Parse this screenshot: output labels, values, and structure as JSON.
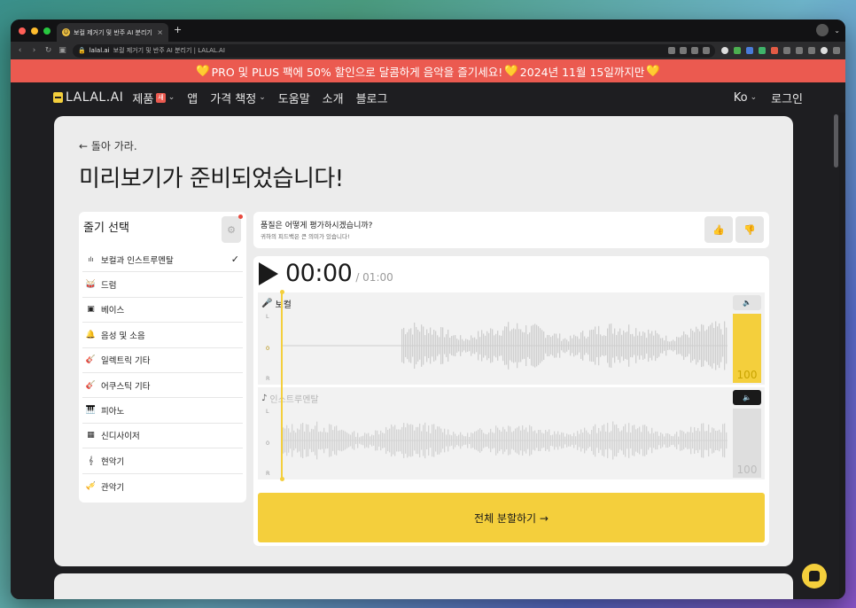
{
  "browser": {
    "tab_title": "보컬 제거기 및 반주 AI 분리기 | L...",
    "tab_close": "×",
    "new_tab": "+",
    "url_domain": "lalal.ai",
    "url_rest": "보컬 제거기 및 반주 AI 분리기 | LALAL.AI"
  },
  "promo": {
    "text": "PRO 및 PLUS 팩에 50% 할인으로 달콤하게 음악을 즐기세요!",
    "date_text": "2024년 11월 15일까지만",
    "heart": "💛"
  },
  "nav": {
    "logo": "LALAL.AI",
    "items": [
      "제품",
      "앱",
      "가격 책정",
      "도움말",
      "소개",
      "블로그"
    ],
    "new_badge": "새",
    "lang": "Ko",
    "login": "로그인"
  },
  "page": {
    "back": "← 돌아 가라.",
    "title": "미리보기가 준비되었습니다!"
  },
  "stems": {
    "title": "줄기 선택",
    "items": [
      {
        "label": "보컬과 인스트루멘탈",
        "icon": "vocal-instrumental-icon",
        "selected": true
      },
      {
        "label": "드럼",
        "icon": "drum-icon",
        "selected": false
      },
      {
        "label": "베이스",
        "icon": "bass-icon",
        "selected": false
      },
      {
        "label": "음성 및 소음",
        "icon": "voice-icon",
        "selected": false
      },
      {
        "label": "일렉트릭 기타",
        "icon": "electric-guitar-icon",
        "selected": false
      },
      {
        "label": "어쿠스틱 기타",
        "icon": "acoustic-guitar-icon",
        "selected": false
      },
      {
        "label": "피아노",
        "icon": "piano-icon",
        "selected": false
      },
      {
        "label": "신디사이저",
        "icon": "synth-icon",
        "selected": false
      },
      {
        "label": "현악기",
        "icon": "strings-icon",
        "selected": false
      },
      {
        "label": "관악기",
        "icon": "wind-icon",
        "selected": false
      }
    ]
  },
  "feedback": {
    "question": "품질은 어떻게 평가하시겠습니까?",
    "subtext": "귀하의 피드백은 큰 의미가 있습니다!"
  },
  "player": {
    "current_time": "00:00",
    "total_time": "/ 01:00",
    "tracks": [
      {
        "label": "보컬",
        "volume": "100",
        "volume_level": 1.0,
        "active": true
      },
      {
        "label": "인스트루멘탈",
        "volume": "100",
        "volume_level": 1.0,
        "active": false
      }
    ],
    "channel_left": "L",
    "channel_center": "0",
    "channel_right": "R",
    "split_button": "전체 분할하기 →"
  },
  "colors": {
    "accent": "#f4cf3c",
    "promo_bg": "#eb5a50",
    "dark": "#1e1e21"
  }
}
